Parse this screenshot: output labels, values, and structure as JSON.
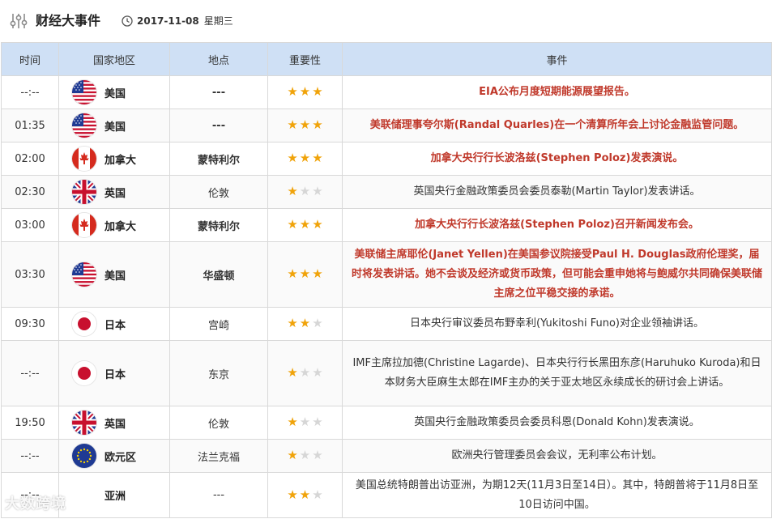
{
  "header": {
    "title": "财经大事件",
    "date": "2017-11-08",
    "weekday": "星期三",
    "settings_icon": "settings-sliders-icon",
    "clock_icon": "clock-icon"
  },
  "table": {
    "columns": [
      "时间",
      "国家地区",
      "地点",
      "重要性",
      "事件"
    ],
    "rows": [
      {
        "time": "--:--",
        "country": "美国",
        "flag": "us-flag-icon",
        "place": "---",
        "place_red": true,
        "importance": 3,
        "event": "EIA公布月度短期能源展望报告。",
        "hot": true
      },
      {
        "time": "01:35",
        "country": "美国",
        "flag": "us-flag-icon",
        "place": "---",
        "place_red": true,
        "importance": 3,
        "event": "美联储理事夸尔斯(Randal Quarles)在一个清算所年会上讨论金融监管问题。",
        "hot": true
      },
      {
        "time": "02:00",
        "country": "加拿大",
        "flag": "canada-flag-icon",
        "place": "蒙特利尔",
        "place_red": true,
        "importance": 3,
        "event": "加拿大央行行长波洛兹(Stephen Poloz)发表演说。",
        "hot": true
      },
      {
        "time": "02:30",
        "country": "英国",
        "flag": "uk-flag-icon",
        "place": "伦敦",
        "place_red": false,
        "importance": 1,
        "event": "英国央行金融政策委员会委员泰勒(Martin Taylor)发表讲话。",
        "hot": false
      },
      {
        "time": "03:00",
        "country": "加拿大",
        "flag": "canada-flag-icon",
        "place": "蒙特利尔",
        "place_red": true,
        "importance": 3,
        "event": "加拿大央行行长波洛兹(Stephen Poloz)召开新闻发布会。",
        "hot": true
      },
      {
        "time": "03:30",
        "country": "美国",
        "flag": "us-flag-icon",
        "place": "华盛顿",
        "place_red": true,
        "importance": 3,
        "event": "美联储主席耶伦(Janet Yellen)在美国参议院接受Paul H. Douglas政府伦理奖，届时将发表讲话。她不会谈及经济或货币政策，但可能会重申她将与鲍威尔共同确保美联储主席之位平稳交接的承诺。",
        "hot": true
      },
      {
        "time": "09:30",
        "country": "日本",
        "flag": "japan-flag-icon",
        "place": "宫崎",
        "place_red": false,
        "importance": 2,
        "event": "日本央行审议委员布野幸利(Yukitoshi Funo)对企业领袖讲话。",
        "hot": false
      },
      {
        "time": "--:--",
        "country": "日本",
        "flag": "japan-flag-icon",
        "place": "东京",
        "place_red": false,
        "importance": 1,
        "event": "IMF主席拉加德(Christine Lagarde)、日本央行行长黑田东彦(Haruhuko Kuroda)和日本财务大臣麻生太郎在IMF主办的关于亚太地区永续成长的研讨会上讲话。",
        "hot": false
      },
      {
        "time": "19:50",
        "country": "英国",
        "flag": "uk-flag-icon",
        "place": "伦敦",
        "place_red": false,
        "importance": 1,
        "event": "英国央行金融政策委员会委员科恩(Donald Kohn)发表演说。",
        "hot": false
      },
      {
        "time": "--:--",
        "country": "欧元区",
        "flag": "eu-flag-icon",
        "place": "法兰克福",
        "place_red": false,
        "importance": 1,
        "event": "欧洲央行管理委员会会议，无利率公布计划。",
        "hot": false
      },
      {
        "time": "--:--",
        "country": "亚洲",
        "flag": "",
        "place": "---",
        "place_red": false,
        "importance": 2,
        "event": "美国总统特朗普出访亚洲，为期12天(11月3日至14日）。其中，特朗普将于11月8日至10日访问中国。",
        "hot": false
      }
    ]
  },
  "watermark": "大数跨境",
  "colors": {
    "header_bg": "#cfe0f5",
    "hot_text": "#c0392b",
    "star_on": "#f0a30a",
    "star_off": "#d6d6d6"
  }
}
